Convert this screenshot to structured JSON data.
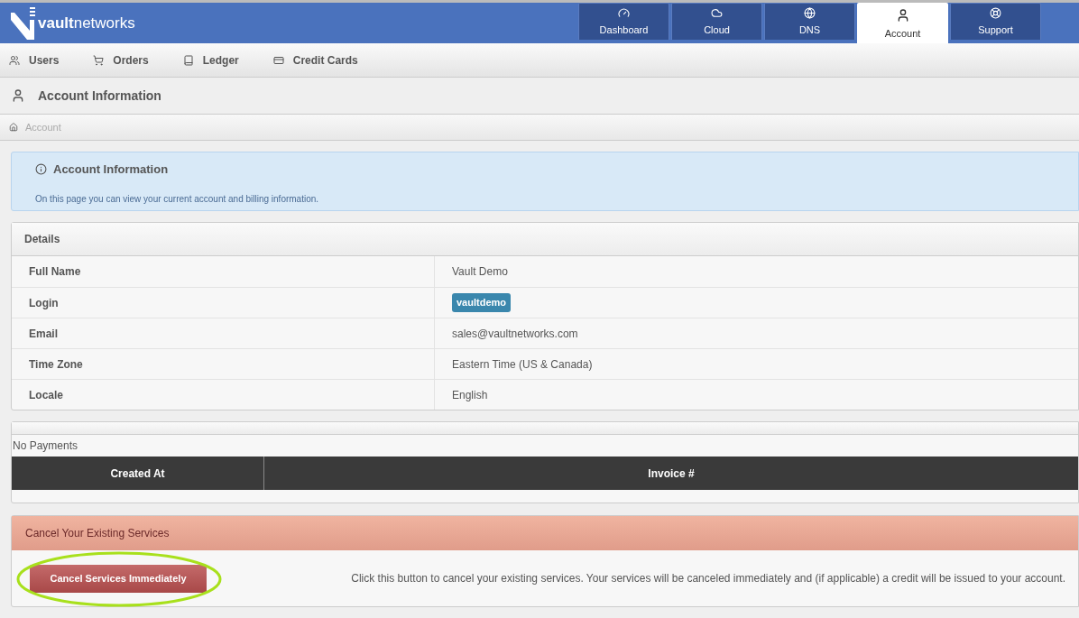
{
  "logo": {
    "text": "**vault**networks"
  },
  "main_tabs": [
    {
      "label": "Dashboard",
      "kind": "dashboard",
      "selected": false
    },
    {
      "label": "Cloud",
      "kind": "cloud",
      "selected": false
    },
    {
      "label": "DNS",
      "kind": "globe",
      "selected": false
    },
    {
      "label": "Account",
      "kind": "user",
      "selected": true
    },
    {
      "label": "Support",
      "kind": "lifebuoy",
      "selected": false
    }
  ],
  "sub_nav": [
    {
      "label": "Users",
      "kind": "users"
    },
    {
      "label": "Orders",
      "kind": "cart"
    },
    {
      "label": "Ledger",
      "kind": "book"
    },
    {
      "label": "Credit Cards",
      "kind": "card"
    }
  ],
  "page_title": "Account Information",
  "breadcrumb": [
    "Account"
  ],
  "info_box": {
    "title": "Account Information",
    "text": "On this page you can view your current account and billing information."
  },
  "details": {
    "title": "Details",
    "rows": [
      {
        "label": "Full Name",
        "value": "Vault Demo",
        "kind": "text"
      },
      {
        "label": "Login",
        "value": "vaultdemo",
        "kind": "badge"
      },
      {
        "label": "Email",
        "value": "sales@vaultnetworks.com",
        "kind": "text"
      },
      {
        "label": "Time Zone",
        "value": "Eastern Time (US & Canada)",
        "kind": "text"
      },
      {
        "label": "Locale",
        "value": "English",
        "kind": "text"
      }
    ]
  },
  "payments": {
    "empty_text": "No Payments",
    "columns": [
      "Created At",
      "Invoice #"
    ]
  },
  "cancel": {
    "title": "Cancel Your Existing Services",
    "button": "Cancel Services Immediately",
    "text": "Click this button to cancel your existing services. Your services will be canceled immediately and (if applicable) a credit will be issued to your account.",
    "highlighted": true
  }
}
